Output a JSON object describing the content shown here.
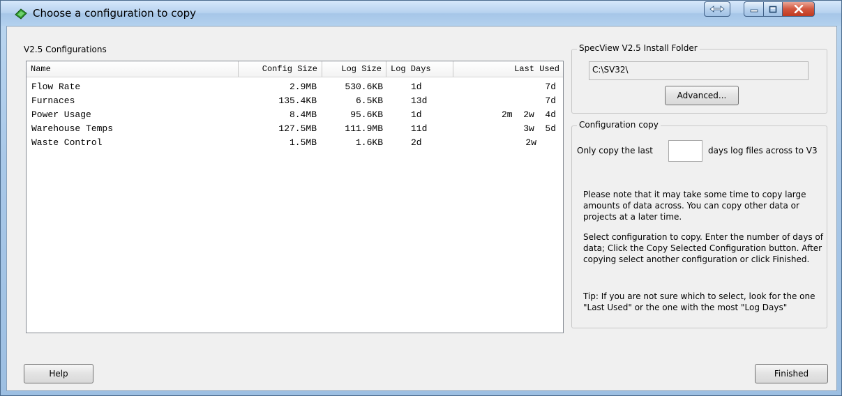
{
  "window": {
    "title": "Choose a configuration to copy"
  },
  "configs": {
    "label": "V2.5 Configurations",
    "columns": [
      "Name",
      "Config Size",
      "Log Size",
      "Log Days",
      "Last Used"
    ],
    "rows": [
      {
        "name": "Flow Rate",
        "config_size": "2.9MB",
        "log_size": "530.6KB",
        "log_days": "1d",
        "last_used": "7d"
      },
      {
        "name": "Furnaces",
        "config_size": "135.4KB",
        "log_size": "6.5KB",
        "log_days": "13d",
        "last_used": "7d"
      },
      {
        "name": "Power Usage",
        "config_size": "8.4MB",
        "log_size": "95.6KB",
        "log_days": "1d",
        "last_used": "2m  2w  4d"
      },
      {
        "name": "Warehouse Temps",
        "config_size": "127.5MB",
        "log_size": "111.9MB",
        "log_days": "11d",
        "last_used": "3w  5d"
      },
      {
        "name": "Waste Control",
        "config_size": "1.5MB",
        "log_size": "1.6KB",
        "log_days": "2d",
        "last_used": "2w"
      }
    ]
  },
  "install": {
    "group_title": "SpecView V2.5 Install Folder",
    "path": "C:\\SV32\\",
    "advanced_label": "Advanced..."
  },
  "copy": {
    "group_title": "Configuration copy",
    "prefix": "Only copy the last",
    "days_value": "",
    "suffix": "days log files across to V3"
  },
  "notes": {
    "note1": "Please note that it may take some time to copy large amounts of data across. You can copy other data or projects at a later time.",
    "note2": "Select configuration to copy. Enter the number of days of data; Click the Copy Selected Configuration button. After copying select another configuration or click Finished.",
    "tip": "Tip: If you are not sure which to select, look for the one \"Last Used\" or the one with the most \"Log Days\""
  },
  "buttons": {
    "help": "Help",
    "finished": "Finished"
  },
  "colors": {
    "title_bar": "#b7d2ef",
    "close_button": "#d2563e",
    "window_bg": "#f0f0f0"
  }
}
